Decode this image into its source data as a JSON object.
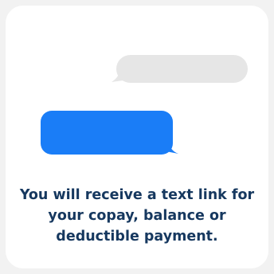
{
  "colors": {
    "background": "#f2f2f2",
    "card": "#ffffff",
    "incoming_bubble": "#e6e6e6",
    "outgoing_bubble": "#1a7df7",
    "caption_text": "#16385f"
  },
  "messages": [
    {
      "direction": "incoming",
      "content": ""
    },
    {
      "direction": "outgoing",
      "content": ""
    }
  ],
  "caption": {
    "text": "You will receive a text link for your copay, balance or deductible payment."
  }
}
